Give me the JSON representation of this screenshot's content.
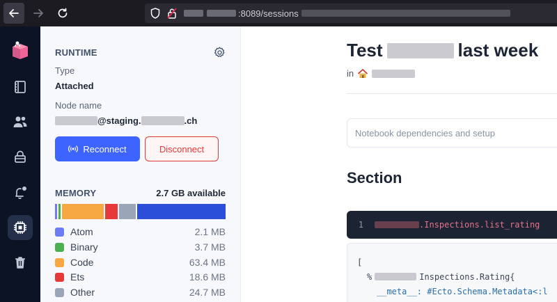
{
  "browser": {
    "url_visible": ":8089/sessions"
  },
  "rail": {
    "items": [
      "livebook-logo-icon",
      "book-icon",
      "users-icon",
      "lock-icon",
      "notification-icon",
      "cpu-icon",
      "trash-icon"
    ]
  },
  "runtime": {
    "heading": "RUNTIME",
    "type_label": "Type",
    "type_value": "Attached",
    "node_label": "Node name",
    "node_part1": "@staging.",
    "node_part2": ".ch",
    "reconnect_label": "Reconnect",
    "disconnect_label": "Disconnect"
  },
  "memory": {
    "heading": "MEMORY",
    "available": "2.7 GB available",
    "items": [
      {
        "name": "Atom",
        "value": "2.1 MB",
        "color": "#6b7cf5"
      },
      {
        "name": "Binary",
        "value": "3.7 MB",
        "color": "#4caf50"
      },
      {
        "name": "Code",
        "value": "63.4 MB",
        "color": "#f7a843"
      },
      {
        "name": "Ets",
        "value": "18.6 MB",
        "color": "#e5393a"
      },
      {
        "name": "Other",
        "value": "24.7 MB",
        "color": "#9aa5b8"
      }
    ],
    "free_color": "#2b4fd8"
  },
  "notebook": {
    "title_start": "Test",
    "title_end": "last week",
    "in_label": "in",
    "deps_label": "Notebook dependencies and setup",
    "section_title": "Section",
    "code_line_number": "1",
    "code_text": ".Inspections.list_rating",
    "output_open": "[",
    "output_line2": "Inspections.Rating{",
    "output_line3": "__meta__: #Ecto.Schema.Metadata<:l"
  }
}
